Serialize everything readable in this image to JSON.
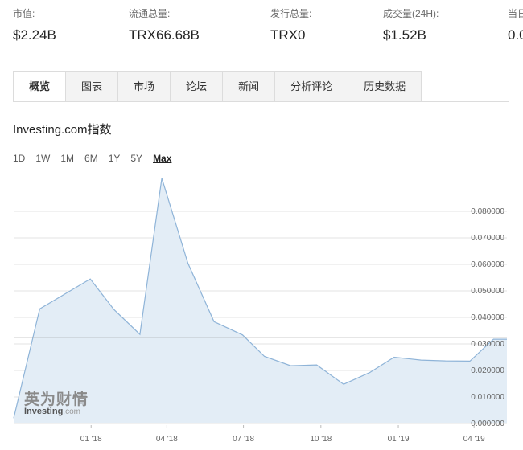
{
  "stats": [
    {
      "label": "市值:",
      "value": "$2.24B"
    },
    {
      "label": "流通总量:",
      "value": "TRX66.68B"
    },
    {
      "label": "发行总量:",
      "value": "TRX0"
    },
    {
      "label": "成交量(24H):",
      "value": "$1.52B"
    },
    {
      "label": "当日",
      "value": "0.0"
    }
  ],
  "tabs": [
    {
      "label": "概览",
      "active": true
    },
    {
      "label": "图表",
      "active": false
    },
    {
      "label": "市场",
      "active": false
    },
    {
      "label": "论坛",
      "active": false
    },
    {
      "label": "新闻",
      "active": false
    },
    {
      "label": "分析评论",
      "active": false
    },
    {
      "label": "历史数据",
      "active": false
    }
  ],
  "chart_title": "Investing.com指数",
  "ranges": [
    {
      "label": "1D",
      "active": false
    },
    {
      "label": "1W",
      "active": false
    },
    {
      "label": "1M",
      "active": false
    },
    {
      "label": "6M",
      "active": false
    },
    {
      "label": "1Y",
      "active": false
    },
    {
      "label": "5Y",
      "active": false
    },
    {
      "label": "Max",
      "active": true
    }
  ],
  "watermark": {
    "cn": "英为财情",
    "en": "Investing",
    "en_suffix": ".com"
  },
  "colors": {
    "line": "#8fb4d8",
    "fill": "#e3edf6",
    "grid": "#e3e3e3",
    "current_line": "#9a9a9a",
    "tick": "#666666"
  },
  "chart_data": {
    "type": "area",
    "xlabel": "",
    "ylabel": "",
    "x_ticks": [
      "01 '18",
      "04 '18",
      "07 '18",
      "10 '18",
      "01 '19",
      "04 '19"
    ],
    "y_ticks": [
      "0.000000",
      "0.010000",
      "0.020000",
      "0.030000",
      "0.040000",
      "0.050000",
      "0.060000",
      "0.070000",
      "0.080000"
    ],
    "ylim": [
      0,
      0.09
    ],
    "current_value": 0.0325,
    "x": [
      "2017-10-01",
      "2017-11-01",
      "2017-12-31",
      "2018-01-28",
      "2018-02-28",
      "2018-03-26",
      "2018-04-26",
      "2018-05-27",
      "2018-06-30",
      "2018-07-26",
      "2018-08-26",
      "2018-09-26",
      "2018-10-28",
      "2018-11-28",
      "2018-12-27",
      "2019-01-28",
      "2019-02-26",
      "2019-03-27",
      "2019-04-24"
    ],
    "y": [
      0.002,
      0.0432,
      0.0545,
      0.043,
      0.0336,
      0.0925,
      0.0605,
      0.0384,
      0.0334,
      0.0253,
      0.0218,
      0.0221,
      0.0148,
      0.0192,
      0.025,
      0.0239,
      0.0236,
      0.0235,
      0.0318
    ]
  }
}
